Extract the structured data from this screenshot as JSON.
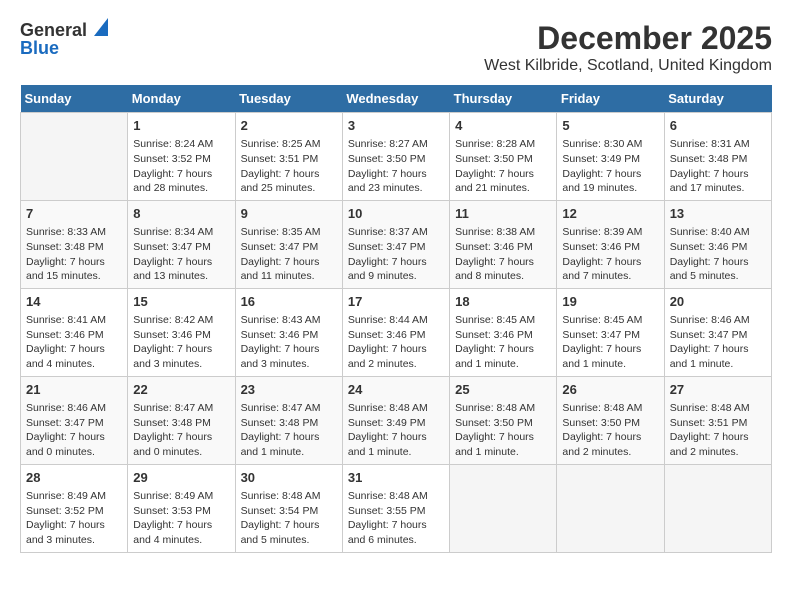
{
  "logo": {
    "line1": "General",
    "line2": "Blue"
  },
  "title": "December 2025",
  "subtitle": "West Kilbride, Scotland, United Kingdom",
  "days_of_week": [
    "Sunday",
    "Monday",
    "Tuesday",
    "Wednesday",
    "Thursday",
    "Friday",
    "Saturday"
  ],
  "weeks": [
    [
      {
        "day": "",
        "content": ""
      },
      {
        "day": "1",
        "content": "Sunrise: 8:24 AM\nSunset: 3:52 PM\nDaylight: 7 hours\nand 28 minutes."
      },
      {
        "day": "2",
        "content": "Sunrise: 8:25 AM\nSunset: 3:51 PM\nDaylight: 7 hours\nand 25 minutes."
      },
      {
        "day": "3",
        "content": "Sunrise: 8:27 AM\nSunset: 3:50 PM\nDaylight: 7 hours\nand 23 minutes."
      },
      {
        "day": "4",
        "content": "Sunrise: 8:28 AM\nSunset: 3:50 PM\nDaylight: 7 hours\nand 21 minutes."
      },
      {
        "day": "5",
        "content": "Sunrise: 8:30 AM\nSunset: 3:49 PM\nDaylight: 7 hours\nand 19 minutes."
      },
      {
        "day": "6",
        "content": "Sunrise: 8:31 AM\nSunset: 3:48 PM\nDaylight: 7 hours\nand 17 minutes."
      }
    ],
    [
      {
        "day": "7",
        "content": "Sunrise: 8:33 AM\nSunset: 3:48 PM\nDaylight: 7 hours\nand 15 minutes."
      },
      {
        "day": "8",
        "content": "Sunrise: 8:34 AM\nSunset: 3:47 PM\nDaylight: 7 hours\nand 13 minutes."
      },
      {
        "day": "9",
        "content": "Sunrise: 8:35 AM\nSunset: 3:47 PM\nDaylight: 7 hours\nand 11 minutes."
      },
      {
        "day": "10",
        "content": "Sunrise: 8:37 AM\nSunset: 3:47 PM\nDaylight: 7 hours\nand 9 minutes."
      },
      {
        "day": "11",
        "content": "Sunrise: 8:38 AM\nSunset: 3:46 PM\nDaylight: 7 hours\nand 8 minutes."
      },
      {
        "day": "12",
        "content": "Sunrise: 8:39 AM\nSunset: 3:46 PM\nDaylight: 7 hours\nand 7 minutes."
      },
      {
        "day": "13",
        "content": "Sunrise: 8:40 AM\nSunset: 3:46 PM\nDaylight: 7 hours\nand 5 minutes."
      }
    ],
    [
      {
        "day": "14",
        "content": "Sunrise: 8:41 AM\nSunset: 3:46 PM\nDaylight: 7 hours\nand 4 minutes."
      },
      {
        "day": "15",
        "content": "Sunrise: 8:42 AM\nSunset: 3:46 PM\nDaylight: 7 hours\nand 3 minutes."
      },
      {
        "day": "16",
        "content": "Sunrise: 8:43 AM\nSunset: 3:46 PM\nDaylight: 7 hours\nand 3 minutes."
      },
      {
        "day": "17",
        "content": "Sunrise: 8:44 AM\nSunset: 3:46 PM\nDaylight: 7 hours\nand 2 minutes."
      },
      {
        "day": "18",
        "content": "Sunrise: 8:45 AM\nSunset: 3:46 PM\nDaylight: 7 hours\nand 1 minute."
      },
      {
        "day": "19",
        "content": "Sunrise: 8:45 AM\nSunset: 3:47 PM\nDaylight: 7 hours\nand 1 minute."
      },
      {
        "day": "20",
        "content": "Sunrise: 8:46 AM\nSunset: 3:47 PM\nDaylight: 7 hours\nand 1 minute."
      }
    ],
    [
      {
        "day": "21",
        "content": "Sunrise: 8:46 AM\nSunset: 3:47 PM\nDaylight: 7 hours\nand 0 minutes."
      },
      {
        "day": "22",
        "content": "Sunrise: 8:47 AM\nSunset: 3:48 PM\nDaylight: 7 hours\nand 0 minutes."
      },
      {
        "day": "23",
        "content": "Sunrise: 8:47 AM\nSunset: 3:48 PM\nDaylight: 7 hours\nand 1 minute."
      },
      {
        "day": "24",
        "content": "Sunrise: 8:48 AM\nSunset: 3:49 PM\nDaylight: 7 hours\nand 1 minute."
      },
      {
        "day": "25",
        "content": "Sunrise: 8:48 AM\nSunset: 3:50 PM\nDaylight: 7 hours\nand 1 minute."
      },
      {
        "day": "26",
        "content": "Sunrise: 8:48 AM\nSunset: 3:50 PM\nDaylight: 7 hours\nand 2 minutes."
      },
      {
        "day": "27",
        "content": "Sunrise: 8:48 AM\nSunset: 3:51 PM\nDaylight: 7 hours\nand 2 minutes."
      }
    ],
    [
      {
        "day": "28",
        "content": "Sunrise: 8:49 AM\nSunset: 3:52 PM\nDaylight: 7 hours\nand 3 minutes."
      },
      {
        "day": "29",
        "content": "Sunrise: 8:49 AM\nSunset: 3:53 PM\nDaylight: 7 hours\nand 4 minutes."
      },
      {
        "day": "30",
        "content": "Sunrise: 8:48 AM\nSunset: 3:54 PM\nDaylight: 7 hours\nand 5 minutes."
      },
      {
        "day": "31",
        "content": "Sunrise: 8:48 AM\nSunset: 3:55 PM\nDaylight: 7 hours\nand 6 minutes."
      },
      {
        "day": "",
        "content": ""
      },
      {
        "day": "",
        "content": ""
      },
      {
        "day": "",
        "content": ""
      }
    ]
  ]
}
